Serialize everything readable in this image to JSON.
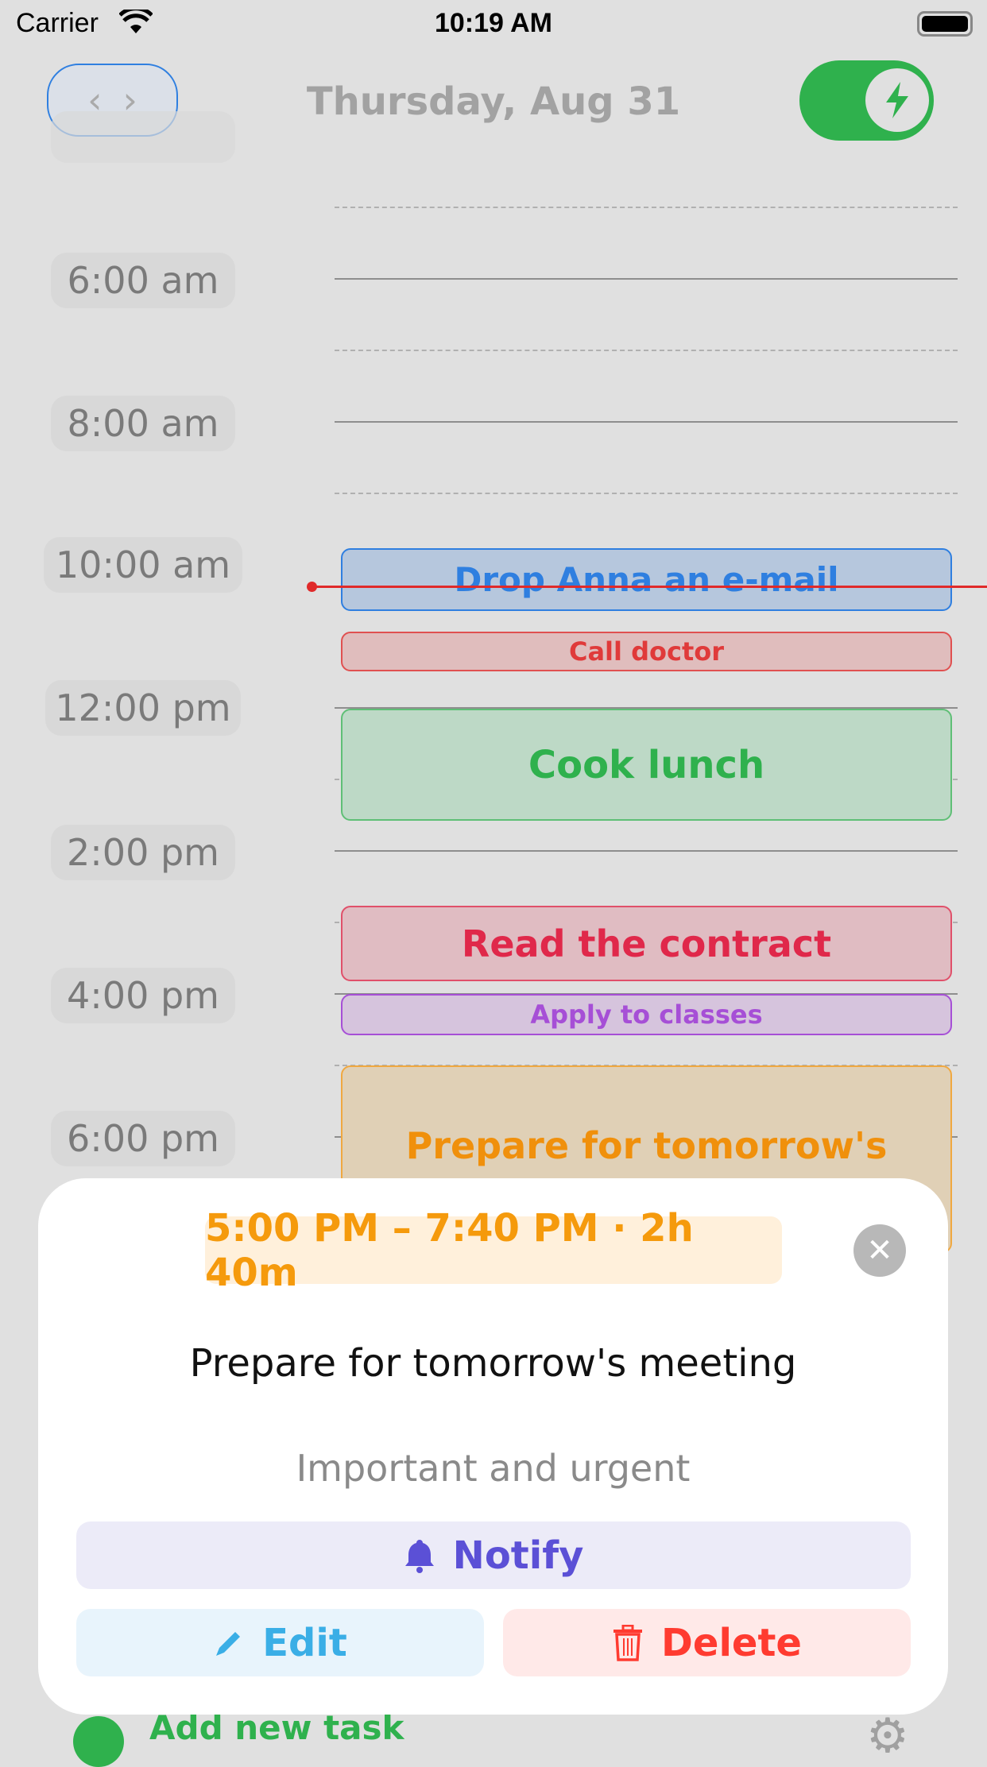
{
  "status_bar": {
    "carrier": "Carrier",
    "time": "10:19 AM"
  },
  "header": {
    "title": "Thursday, Aug 31",
    "prev": "‹",
    "next": "›",
    "toggle_on": true
  },
  "timeline": {
    "labels": [
      "6:00 am",
      "8:00 am",
      "10:00 am",
      "12:00 pm",
      "2:00 pm",
      "4:00 pm",
      "6:00 pm"
    ]
  },
  "events": [
    {
      "title": "Drop Anna an e-mail",
      "color": "#2f7fe0"
    },
    {
      "title": "Call doctor",
      "color": "#e03a3a"
    },
    {
      "title": "Cook lunch",
      "color": "#2fb14d"
    },
    {
      "title": "Read the contract",
      "color": "#e0284a"
    },
    {
      "title": "Apply to classes",
      "color": "#a64fd6"
    },
    {
      "title": "Prepare for tomorrow's meeting",
      "color": "#f59a0c"
    }
  ],
  "sheet": {
    "time_range": "5:00 PM – 7:40 PM · 2h 40m",
    "title": "Prepare for tomorrow's meeting",
    "priority": "Important and urgent",
    "notify": "Notify",
    "edit": "Edit",
    "delete": "Delete"
  },
  "footer": {
    "add_task": "Add new task"
  }
}
